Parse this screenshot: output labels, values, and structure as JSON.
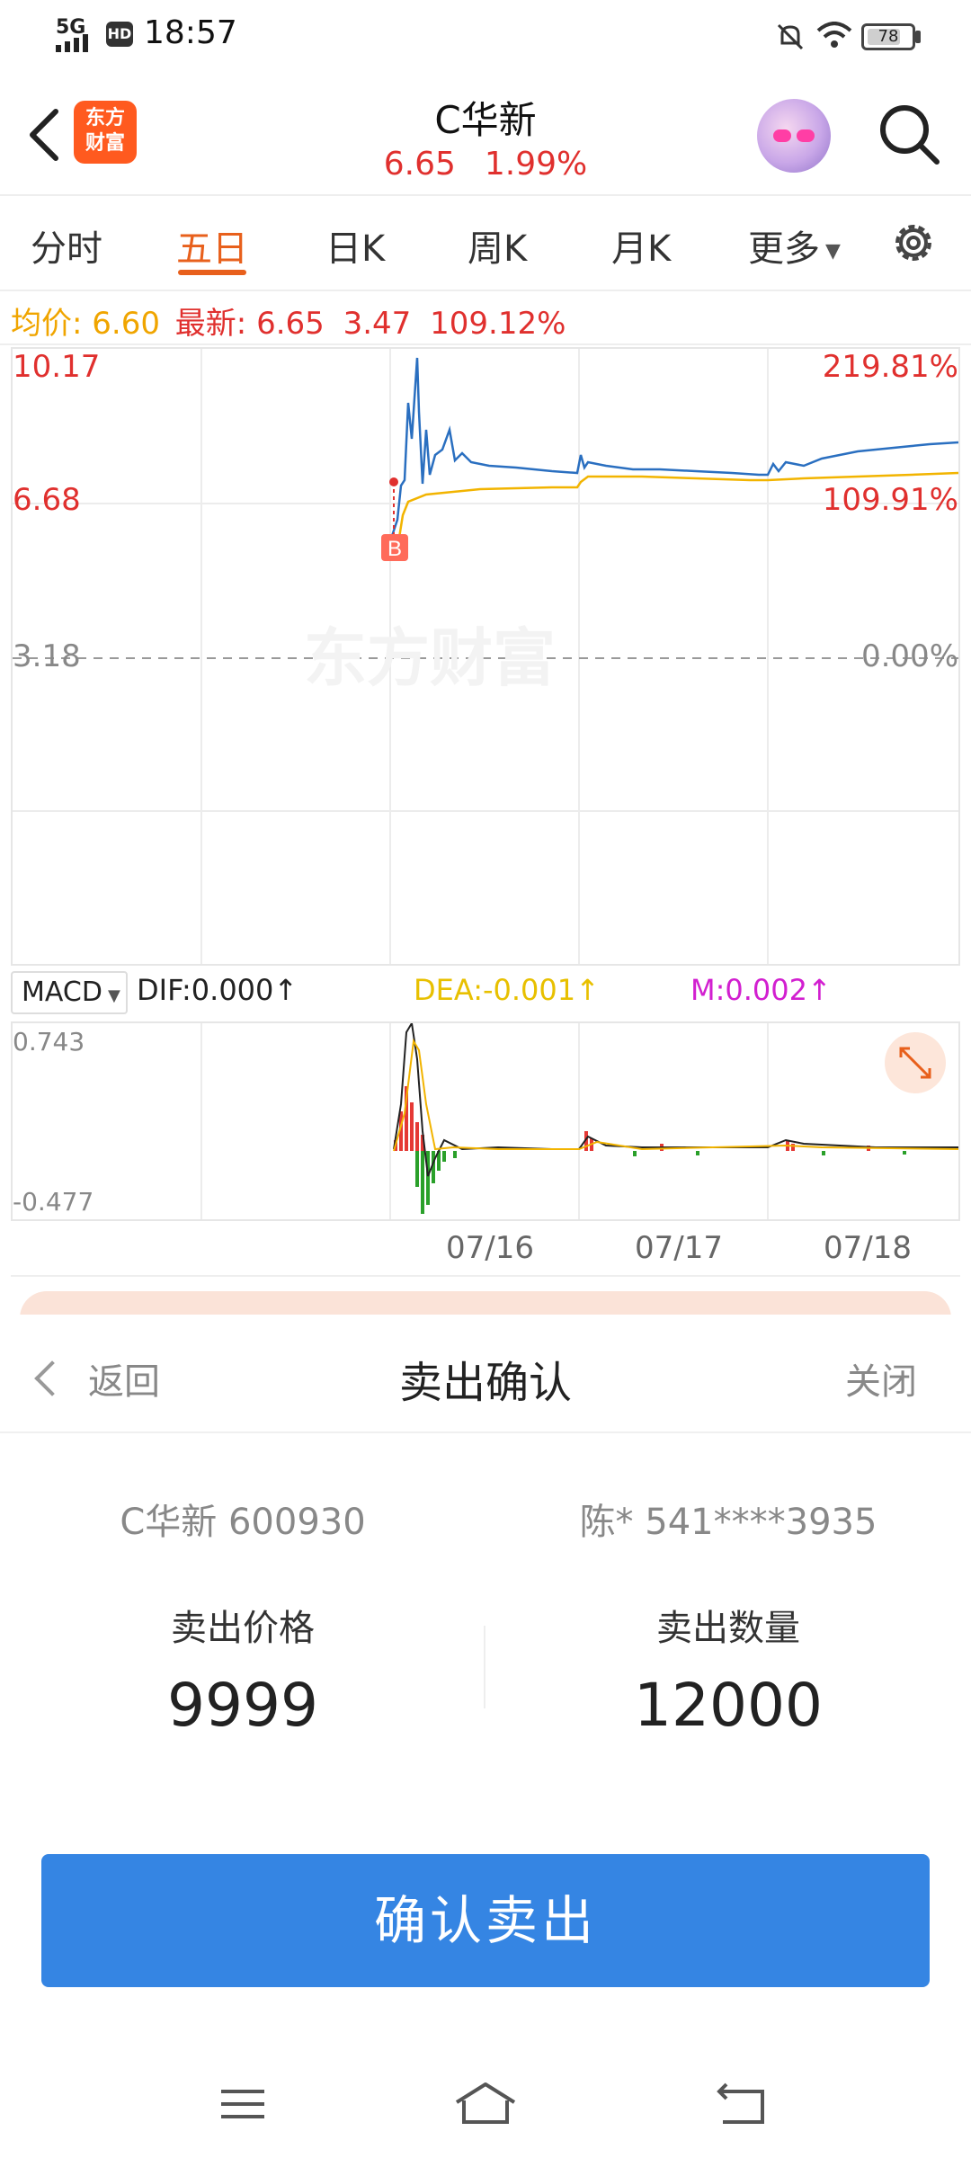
{
  "status_bar": {
    "network": "5G",
    "hd": "HD",
    "time": "18:57",
    "battery": "78",
    "battery_level": 0.78
  },
  "header": {
    "logo_text_line1": "东方",
    "logo_text_line2": "财富",
    "title": "C华新",
    "price": "6.65",
    "change_pct": "1.99%"
  },
  "tabs": [
    {
      "label": "分时",
      "active": false
    },
    {
      "label": "五日",
      "active": true
    },
    {
      "label": "日K",
      "active": false
    },
    {
      "label": "周K",
      "active": false
    },
    {
      "label": "月K",
      "active": false
    },
    {
      "label": "更多",
      "active": false
    }
  ],
  "info_line": {
    "avg_label": "均价:",
    "avg_value": "6.60",
    "latest_label": "最新:",
    "latest_value": "6.65",
    "change": "3.47",
    "change_pct": "109.12%"
  },
  "chart": {
    "y_top": "10.17",
    "y_mid": "6.68",
    "y_base": "3.18",
    "pct_top": "219.81%",
    "pct_mid": "109.91%",
    "pct_base": "0.00%",
    "buy_marker": "B",
    "watermark": "东方财富",
    "dates": [
      "07/16",
      "07/17",
      "07/18"
    ]
  },
  "macd": {
    "selector": "MACD",
    "dif": "DIF:0.000",
    "dea": "DEA:-0.001",
    "m": "M:0.002",
    "y_top": "0.743",
    "y_bottom": "-0.477"
  },
  "sheet": {
    "back_label": "返回",
    "title": "卖出确认",
    "close_label": "关闭",
    "stock_info": "C华新 600930",
    "account_info": "陈* 541****3935",
    "price_label": "卖出价格",
    "price_value": "9999",
    "qty_label": "卖出数量",
    "qty_value": "12000",
    "confirm_label": "确认卖出"
  },
  "colors": {
    "accent": "#e8601c",
    "up_red": "#e0302e",
    "avg_yellow": "#f0a500",
    "price_blue": "#2a6fc0",
    "button_blue": "#3585e3"
  }
}
